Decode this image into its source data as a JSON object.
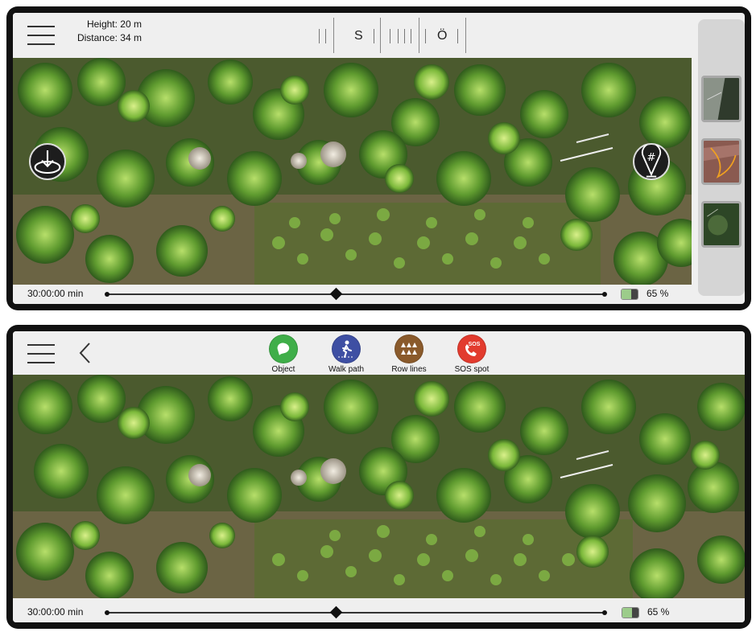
{
  "top_view": {
    "telemetry": {
      "height": "Height: 20 m",
      "distance": "Distance: 34 m"
    },
    "compass": {
      "south": "S",
      "east": "Ö"
    },
    "timeline": {
      "time": "30:00:00 min",
      "position": 0.46
    },
    "battery": {
      "percent_text": "65 %",
      "level": 0.65
    },
    "buttons": {
      "download_icon": "download-tray-icon",
      "tag_icon": "hashtag-pin-icon"
    },
    "thumbnails": [
      "satellite-forest-thumbnail",
      "terrain-map-thumbnail",
      "green-satellite-thumbnail"
    ]
  },
  "bottom_view": {
    "tools": [
      {
        "label": "Object",
        "color": "#3fae49",
        "icon": "object-bubble-icon"
      },
      {
        "label": "Walk path",
        "color": "#3e4fa3",
        "icon": "walking-person-icon"
      },
      {
        "label": "Row lines",
        "color": "#8a5a2b",
        "icon": "row-trees-icon"
      },
      {
        "label": "SOS spot",
        "color": "#e23b2e",
        "icon": "sos-phone-icon"
      }
    ],
    "timeline": {
      "time": "30:00:00 min",
      "position": 0.46
    },
    "battery": {
      "percent_text": "65 %",
      "level": 0.65
    }
  },
  "colors": {
    "bar": "#efefef",
    "frame": "#111111",
    "battery_fill": "#9ccc8a"
  }
}
